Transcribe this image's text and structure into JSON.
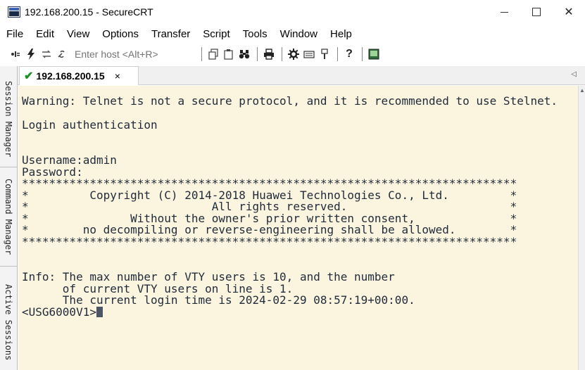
{
  "window": {
    "title": "192.168.200.15 - SecureCRT",
    "controls": {
      "minimize": "",
      "maximize": "",
      "close": "✕"
    }
  },
  "menu": [
    "File",
    "Edit",
    "View",
    "Options",
    "Transfer",
    "Script",
    "Tools",
    "Window",
    "Help"
  ],
  "toolbar": {
    "host_placeholder": "Enter host <Alt+R>",
    "icons": [
      "connect-bar-icon",
      "lightning-icon",
      "reconnect-icon",
      "link-icon",
      "copy-icon",
      "paste-icon",
      "find-icon",
      "print-icon",
      "settings-icon",
      "keymap-icon",
      "sftp-icon",
      "help-icon",
      "screen-icon"
    ],
    "help_glyph": "?"
  },
  "tabs": [
    {
      "label": "192.168.200.15",
      "status": "connected",
      "close": "×"
    }
  ],
  "side_panels": [
    "Session Manager",
    "Command Manager",
    "Active Sessions"
  ],
  "terminal": {
    "background": "#fbf4de",
    "lines": [
      "Warning: Telnet is not a secure protocol, and it is recommended to use Stelnet.",
      "",
      "Login authentication",
      "",
      "",
      "Username:admin",
      "Password:",
      "*************************************************************************",
      "*         Copyright (C) 2014-2018 Huawei Technologies Co., Ltd.         *",
      "*                           All rights reserved.                        *",
      "*               Without the owner's prior written consent,              *",
      "*        no decompiling or reverse-engineering shall be allowed.        *",
      "*************************************************************************",
      "",
      "",
      "Info: The max number of VTY users is 10, and the number",
      "      of current VTY users on line is 1.",
      "      The current login time is 2024-02-29 08:57:19+00:00.",
      "<USG6000V1>"
    ]
  }
}
